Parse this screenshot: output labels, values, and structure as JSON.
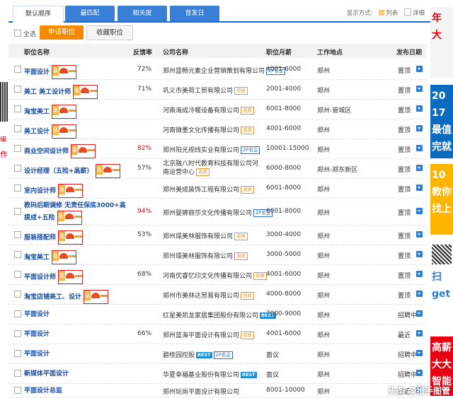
{
  "tabs": [
    "默认顺序",
    "最匹配",
    "相关度",
    "首发日"
  ],
  "display_mode": {
    "label": "显示方式:",
    "list": "列表",
    "detail": "详细"
  },
  "toolbar": {
    "select_all": "全选",
    "apply": "申请职位",
    "favorite": "收藏职位"
  },
  "columns": {
    "title": "职位名称",
    "rate": "反馈率",
    "company": "公司名称",
    "salary": "职位月薪",
    "location": "工作地点",
    "date": "发布日期"
  },
  "tag_text": "急",
  "rows": [
    {
      "title": "平面设计",
      "title_hl": true,
      "tag": true,
      "rate": "72%",
      "rate_hi": false,
      "company": "郑州蓝畅元素企业营销策划有限公司",
      "badges": [
        "ZP名企"
      ],
      "salary": "4001-6000",
      "location": "郑州",
      "date": "置顶"
    },
    {
      "title": "美工  美工设计师",
      "title_hl": false,
      "tag": true,
      "rate": "71%",
      "rate_hi": false,
      "company": "巩义市美荷工贸有限公司",
      "badges": [
        "资质"
      ],
      "salary": "2001-4000",
      "location": "郑州",
      "date": "置顶"
    },
    {
      "title": "淘宝美工",
      "title_hl": false,
      "tag": true,
      "rate": "",
      "rate_hi": false,
      "company": "河南海成冷暖设备有限公司",
      "badges": [
        "资质"
      ],
      "salary": "6001-8000",
      "location": "郑州-管城区",
      "date": "置顶"
    },
    {
      "title": "美工设计",
      "title_hl": false,
      "tag": true,
      "rate": "",
      "rate_hi": false,
      "company": "河南微墨文化传播有限公司",
      "badges": [
        "资质"
      ],
      "salary": "4001-6000",
      "location": "郑州",
      "date": "置顶"
    },
    {
      "title": "商业空间设计师",
      "title_hl": false,
      "tag": true,
      "rate": "82%",
      "rate_hi": true,
      "company": "郑州阳光视线实业有限公司",
      "badges": [
        "ZP名企"
      ],
      "salary": "10001-15000",
      "location": "郑州",
      "date": "置顶"
    },
    {
      "title": "设计经理（五险+高薪）",
      "title_hl": false,
      "tag": true,
      "rate": "57%",
      "rate_hi": false,
      "company": "北京融八时代教育科技有限公司河南运营中心",
      "badges": [
        "资质"
      ],
      "salary": "6000-8000",
      "location": "郑州-郑东新区",
      "date": "置顶"
    },
    {
      "title": "室内设计师",
      "title_hl": false,
      "tag": true,
      "rate": "",
      "rate_hi": false,
      "company": "郑州美成装饰工程有限公司",
      "badges": [
        "资质"
      ],
      "salary": "6001-8000",
      "location": "郑州",
      "date": "置顶"
    },
    {
      "title": "教码后期调修  无责任保底3000+高提成+五险",
      "title_hl": false,
      "tag": true,
      "rate": "94%",
      "rate_hi": true,
      "company": "郑州婴狮丽莎文化传播有限公司",
      "badges": [
        "ZP名企"
      ],
      "salary": "6001-8000",
      "location": "郑州",
      "date": "置顶"
    },
    {
      "title": "服装搭配师",
      "title_hl": false,
      "tag": true,
      "rate": "53%",
      "rate_hi": false,
      "company": "郑州璟美林服饰有限公司",
      "badges": [
        "资质"
      ],
      "salary": "3000-4000",
      "location": "郑州",
      "date": "置顶"
    },
    {
      "title": "淘宝美工",
      "title_hl": false,
      "tag": true,
      "rate": "",
      "rate_hi": false,
      "company": "郑州璟美林服饰有限公司",
      "badges": [
        "资质"
      ],
      "salary": "3000-5000",
      "location": "郑州",
      "date": "置顶"
    },
    {
      "title": "平面设计师",
      "title_hl": true,
      "tag": true,
      "rate": "68%",
      "rate_hi": false,
      "company": "河南优睿忆印文化传播有限公司",
      "badges": [
        "资质"
      ],
      "salary": "4001-6000",
      "location": "郑州",
      "date": "置顶"
    },
    {
      "title": "淘宝店铺美工、设计",
      "title_hl": false,
      "tag": true,
      "rate": "",
      "rate_hi": false,
      "company": "郑州市美林达贸易有限公司",
      "badges": [
        "资质"
      ],
      "salary": "4000-8000",
      "location": "郑州",
      "date": "置顶"
    },
    {
      "title": "平面设计",
      "title_hl": true,
      "tag": false,
      "rate": "",
      "rate_hi": false,
      "company": "红星美凯龙家居集团股份有限公司",
      "badges": [
        "BEST"
      ],
      "salary": "7000-9000",
      "location": "郑州",
      "date": "招聘中"
    },
    {
      "title": "平面设计",
      "title_hl": true,
      "tag": false,
      "rate": "66%",
      "rate_hi": false,
      "company": "郑州蓝海平面设计有限公司",
      "badges": [
        "资质"
      ],
      "salary": "4001-6000",
      "location": "郑州",
      "date": "最近"
    },
    {
      "title": "平面设计",
      "title_hl": true,
      "tag": false,
      "rate": "",
      "rate_hi": false,
      "company": "碧桂园控股",
      "badges": [
        "BEST",
        "ZP名企"
      ],
      "salary": "面议",
      "location": "郑州",
      "date": "招聘中"
    },
    {
      "title": "新媒体平面设计",
      "title_hl": false,
      "tag": false,
      "rate": "",
      "rate_hi": false,
      "company": "华夏幸福基业股份有限公司",
      "badges": [
        "BEST"
      ],
      "salary": "面议",
      "location": "郑州",
      "date": "招聘中"
    },
    {
      "title": "平面设计总监",
      "title_hl": true,
      "tag": false,
      "rate": "",
      "rate_hi": false,
      "company": "郑州玩尚平面设计有限公司",
      "badges": [],
      "salary": "8001-10000",
      "location": "郑州",
      "date": "最近"
    }
  ],
  "sidebar_ads": [
    {
      "text": "年 大",
      "bg": "#f4f4f4",
      "fg": "#e60012"
    },
    {
      "text": "2017 最值 完就",
      "bg": "#0b6cbf",
      "fg": "#fff"
    },
    {
      "text": "10 教你 找上",
      "bg": "#ffb400",
      "fg": "#fff"
    },
    {
      "text": "扫 get",
      "bg": "#fff",
      "fg": "#2a7ed8"
    },
    {
      "text": "高薪 大大 智能",
      "bg": "#e60012",
      "fg": "#fff"
    }
  ],
  "left_texts": [
    "编",
    "作"
  ],
  "watermark": "头条 @猎手图管",
  "colors": {
    "accent": "#1a6dd8",
    "apply": "#f58a00",
    "red": "#e60012"
  }
}
